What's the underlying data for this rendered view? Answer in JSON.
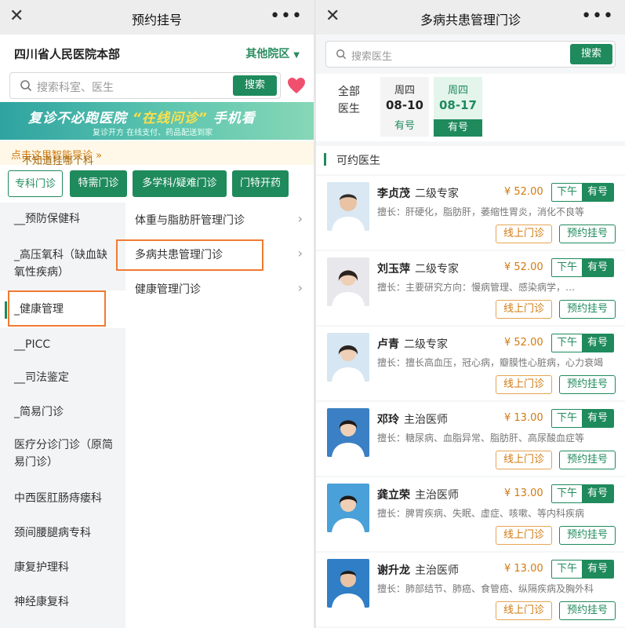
{
  "left": {
    "titlebar": {
      "close": "✕",
      "title": "预约挂号",
      "more": "•••"
    },
    "hospital": {
      "name": "四川省人民医院本部",
      "other_campus": "其他院区"
    },
    "search": {
      "placeholder": "搜索科室、医生",
      "button": "搜索"
    },
    "banner": {
      "main_prefix": "复诊不必跑医院",
      "main_highlight": "“在线问诊”",
      "main_suffix": "手机看",
      "sub": "复诊开方    在线支付、药品配送到家"
    },
    "guide": {
      "prefix": "不知道挂哪个科室?",
      "link": "点击这里智能导诊 »"
    },
    "dept_tabs": [
      "专科门诊",
      "特需门诊",
      "多学科/疑难门诊",
      "门特开药"
    ],
    "sidebar": [
      "__预防保健科",
      "_高压氧科（缺血缺氧性疾病）",
      "_健康管理",
      "__PICC",
      "__司法鉴定",
      "_简易门诊",
      "医疗分诊门诊（原简易门诊）",
      "中西医肛肠痔瘘科",
      "颈间腰腿病专科",
      "康复护理科",
      "神经康复科"
    ],
    "subdepts": [
      "体重与脂肪肝管理门诊",
      "多病共患管理门诊",
      "健康管理门诊"
    ]
  },
  "right": {
    "titlebar": {
      "close": "✕",
      "title": "多病共患管理门诊",
      "more": "•••"
    },
    "search": {
      "placeholder": "搜索医生",
      "button": "搜索"
    },
    "dates": {
      "all_line1": "全部",
      "all_line2": "医生",
      "cards": [
        {
          "weekday": "周四",
          "date": "08-10",
          "status": "有号"
        },
        {
          "weekday": "周四",
          "date": "08-17",
          "status": "有号"
        }
      ]
    },
    "section_title": "可约医生",
    "doctors": [
      {
        "name": "李贞茂",
        "level": "二级专家",
        "price": "¥ 52.00",
        "period": "下午",
        "availability": "有号",
        "specialty": "擅长：肝硬化，脂肪肝，萎缩性胃炎，消化不良等",
        "online": "线上门诊",
        "book": "预约挂号"
      },
      {
        "name": "刘玉萍",
        "level": "二级专家",
        "price": "¥ 52.00",
        "period": "下午",
        "availability": "有号",
        "specialty": "擅长：主要研究方向：慢病管理、感染病学，…",
        "online": "线上门诊",
        "book": "预约挂号"
      },
      {
        "name": "卢青",
        "level": "二级专家",
        "price": "¥ 52.00",
        "period": "下午",
        "availability": "有号",
        "specialty": "擅长：擅长高血压，冠心病，瓣膜性心脏病，心力衰竭",
        "online": "线上门诊",
        "book": "预约挂号"
      },
      {
        "name": "邓玲",
        "level": "主治医师",
        "price": "¥ 13.00",
        "period": "下午",
        "availability": "有号",
        "specialty": "擅长：糖尿病、血脂异常、脂肪肝、高尿酸血症等",
        "online": "线上门诊",
        "book": "预约挂号"
      },
      {
        "name": "龚立荣",
        "level": "主治医师",
        "price": "¥ 13.00",
        "period": "下午",
        "availability": "有号",
        "specialty": "擅长：脾胃疾病、失眠、虚症、咳嗽、等内科疾病",
        "online": "线上门诊",
        "book": "预约挂号"
      },
      {
        "name": "谢升龙",
        "level": "主治医师",
        "price": "¥ 13.00",
        "period": "下午",
        "availability": "有号",
        "specialty": "擅长：肺部结节、肺癌、食管癌、纵隔疾病及胸外科",
        "online": "线上门诊",
        "book": "预约挂号"
      }
    ]
  },
  "colors": {
    "primary": "#1f8a5c",
    "accent": "#d27a10",
    "highlight_box": "#ef7b33",
    "heart": "#f0506e"
  }
}
